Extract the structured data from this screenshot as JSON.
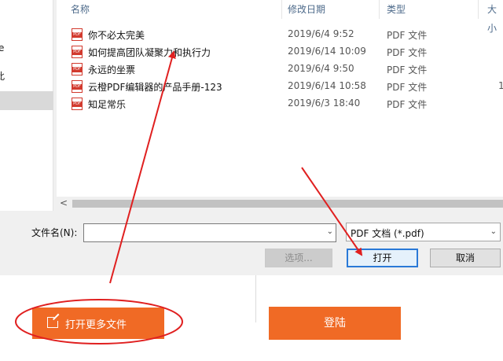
{
  "sidebar": {
    "items": [
      {
        "label": "e"
      },
      {
        "label": "此"
      }
    ]
  },
  "file_list": {
    "columns": [
      "名称",
      "修改日期",
      "类型",
      "大小"
    ],
    "rows": [
      {
        "name": "你不必太完美",
        "date": "2019/6/4 9:52",
        "type": "PDF 文件",
        "size": ""
      },
      {
        "name": "如何提高团队凝聚力和执行力",
        "date": "2019/6/14 10:09",
        "type": "PDF 文件",
        "size": ""
      },
      {
        "name": "永远的坐票",
        "date": "2019/6/4 9:50",
        "type": "PDF 文件",
        "size": ""
      },
      {
        "name": "云橙PDF编辑器的产品手册-123",
        "date": "2019/6/14 10:58",
        "type": "PDF 文件",
        "size": "1"
      },
      {
        "name": "知足常乐",
        "date": "2019/6/3 18:40",
        "type": "PDF 文件",
        "size": ""
      }
    ]
  },
  "filename": {
    "label": "文件名(N):",
    "value": ""
  },
  "filetype": {
    "selected": "PDF 文档 (*.pdf)"
  },
  "buttons": {
    "options": "选项...",
    "open": "打开",
    "cancel": "取消"
  },
  "app": {
    "open_more_label": "打开更多文件",
    "login_label": "登陆"
  },
  "colors": {
    "accent": "#f06a25",
    "annotation": "#e02020",
    "primary_border": "#2a79d7"
  },
  "icons": {
    "file": "pdf-file-icon",
    "open_external": "open-external-icon",
    "scroll_left": "arrow-left-icon",
    "dropdown": "chevron-down-icon"
  }
}
